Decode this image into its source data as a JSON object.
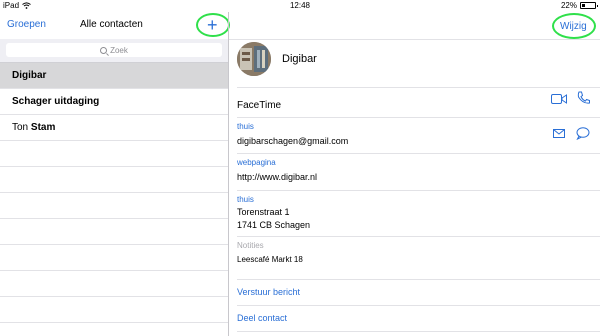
{
  "status_bar": {
    "device": "iPad",
    "time": "12:48",
    "battery": "22%",
    "battery_level": 0.22
  },
  "left_nav": {
    "back_label": "Groepen",
    "title": "Alle contacten",
    "add_label": "+"
  },
  "search": {
    "placeholder": "Zoek"
  },
  "contacts": [
    {
      "normal": "",
      "bold": "Digibar"
    },
    {
      "normal": "",
      "bold": "Schager uitdaging"
    },
    {
      "normal": "Ton ",
      "bold": "Stam"
    }
  ],
  "right_nav": {
    "edit_label": "Wijzig"
  },
  "contact": {
    "name": "Digibar",
    "facetime_label": "FaceTime",
    "email_type": "thuis",
    "email": "digibarschagen@gmail.com",
    "web_type": "webpagina",
    "web": "http://www.digibar.nl",
    "address_type": "thuis",
    "address_line1": "Torenstraat 1",
    "address_line2": "1741 CB Schagen",
    "notes_label": "Notities",
    "notes": "Leescafé Markt 18",
    "send_message": "Verstuur bericht",
    "share_contact": "Deel contact"
  },
  "colors": {
    "accent": "#2a6fd6",
    "highlight_circle": "#2fe04a",
    "selected_row": "#d7d7d9"
  },
  "icons": [
    "wifi-icon",
    "search-icon",
    "video-icon",
    "phone-icon",
    "mail-icon",
    "message-icon"
  ]
}
